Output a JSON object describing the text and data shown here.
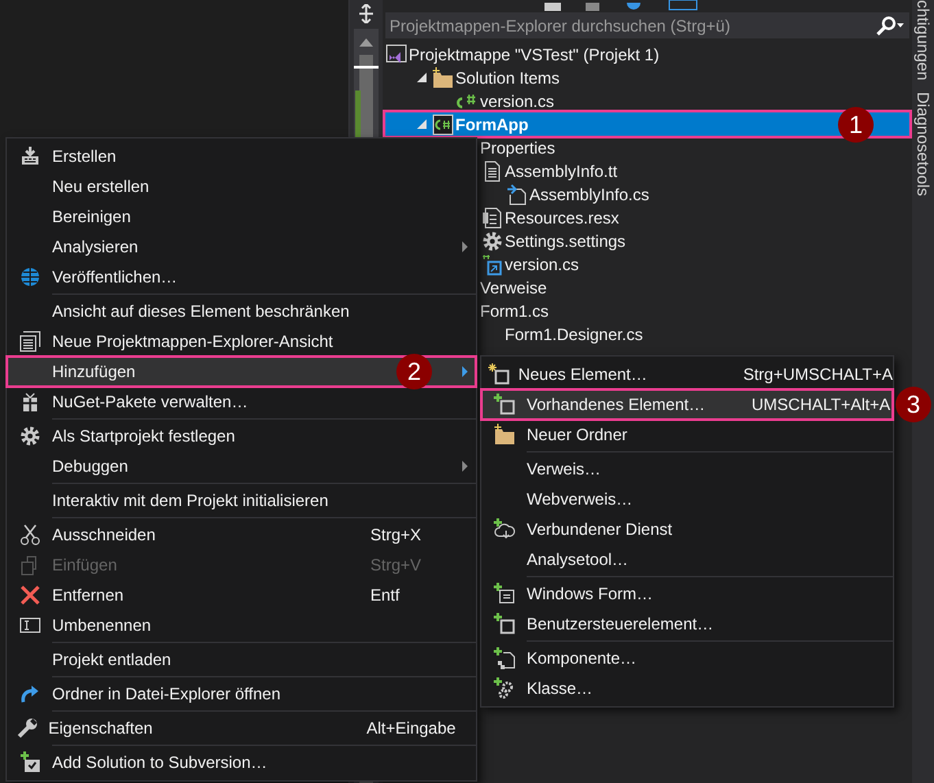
{
  "search": {
    "placeholder": "Projektmappen-Explorer durchsuchen (Strg+ü)"
  },
  "side_tabs": [
    {
      "label": "chtigungen"
    },
    {
      "label": "Diagnosetools"
    }
  ],
  "tree": [
    {
      "label": "Projektmappe \"VSTest\" (Projekt 1)",
      "selected": false,
      "children": [
        {
          "label": "Solution Items",
          "selected": false,
          "expanded": true,
          "children": [
            {
              "label": "version.cs",
              "selected": false
            }
          ]
        },
        {
          "label": "FormApp",
          "selected": true,
          "expanded": true,
          "callout": "1",
          "children": [
            {
              "label": "Properties",
              "selected": false,
              "children": [
                {
                  "label": "AssemblyInfo.tt",
                  "selected": false,
                  "children": [
                    {
                      "label": "AssemblyInfo.cs",
                      "selected": false
                    }
                  ]
                },
                {
                  "label": "Resources.resx",
                  "selected": false
                },
                {
                  "label": "Settings.settings",
                  "selected": false
                },
                {
                  "label": "version.cs",
                  "selected": false
                }
              ]
            },
            {
              "label": "Verweise",
              "selected": false
            },
            {
              "label": "Form1.cs",
              "selected": false,
              "children": [
                {
                  "label": "Form1.Designer.cs",
                  "selected": false
                }
              ]
            }
          ]
        }
      ]
    }
  ],
  "context_menu": {
    "items": [
      {
        "kind": "item",
        "label": "Erstellen",
        "selected": false,
        "disabled": false,
        "submenu": false
      },
      {
        "kind": "item",
        "label": "Neu erstellen",
        "selected": false,
        "disabled": false,
        "submenu": false
      },
      {
        "kind": "item",
        "label": "Bereinigen",
        "selected": false,
        "disabled": false,
        "submenu": false
      },
      {
        "kind": "item",
        "label": "Analysieren",
        "selected": false,
        "disabled": false,
        "submenu": true
      },
      {
        "kind": "item",
        "label": "Veröffentlichen…",
        "selected": false,
        "disabled": false,
        "submenu": false
      },
      {
        "kind": "separator"
      },
      {
        "kind": "item",
        "label": "Ansicht auf dieses Element beschränken",
        "selected": false,
        "disabled": false,
        "submenu": false
      },
      {
        "kind": "item",
        "label": "Neue Projektmappen-Explorer-Ansicht",
        "selected": false,
        "disabled": false,
        "submenu": false
      },
      {
        "kind": "item",
        "label": "Hinzufügen",
        "selected": true,
        "disabled": false,
        "submenu": true,
        "callout": "2"
      },
      {
        "kind": "item",
        "label": "NuGet-Pakete verwalten…",
        "selected": false,
        "disabled": false,
        "submenu": false
      },
      {
        "kind": "separator"
      },
      {
        "kind": "item",
        "label": "Als Startprojekt festlegen",
        "selected": false,
        "disabled": false,
        "submenu": false
      },
      {
        "kind": "item",
        "label": "Debuggen",
        "selected": false,
        "disabled": false,
        "submenu": true
      },
      {
        "kind": "separator"
      },
      {
        "kind": "item",
        "label": "Interaktiv mit dem Projekt initialisieren",
        "selected": false,
        "disabled": false,
        "submenu": false
      },
      {
        "kind": "separator"
      },
      {
        "kind": "item",
        "label": "Ausschneiden",
        "shortcut": "Strg+X",
        "selected": false,
        "disabled": false,
        "submenu": false
      },
      {
        "kind": "item",
        "label": "Einfügen",
        "shortcut": "Strg+V",
        "selected": false,
        "disabled": true,
        "submenu": false
      },
      {
        "kind": "item",
        "label": "Entfernen",
        "shortcut": "Entf",
        "selected": false,
        "disabled": false,
        "submenu": false
      },
      {
        "kind": "item",
        "label": "Umbenennen",
        "selected": false,
        "disabled": false,
        "submenu": false
      },
      {
        "kind": "separator"
      },
      {
        "kind": "item",
        "label": "Projekt entladen",
        "selected": false,
        "disabled": false,
        "submenu": false
      },
      {
        "kind": "separator"
      },
      {
        "kind": "item",
        "label": "Ordner in Datei-Explorer öffnen",
        "selected": false,
        "disabled": false,
        "submenu": false
      },
      {
        "kind": "separator"
      },
      {
        "kind": "item",
        "label": "Eigenschaften",
        "shortcut": "Alt+Eingabe",
        "selected": false,
        "disabled": false,
        "submenu": false
      },
      {
        "kind": "separator"
      },
      {
        "kind": "item",
        "label": "Add Solution to Subversion…",
        "selected": false,
        "disabled": false,
        "submenu": false
      }
    ]
  },
  "submenu": {
    "items": [
      {
        "kind": "item",
        "label": "Neues Element…",
        "shortcut": "Strg+UMSCHALT+A",
        "selected": false,
        "disabled": false
      },
      {
        "kind": "item",
        "label": "Vorhandenes Element…",
        "shortcut": "UMSCHALT+Alt+A",
        "selected": true,
        "disabled": false,
        "callout": "3"
      },
      {
        "kind": "item",
        "label": "Neuer Ordner",
        "selected": false,
        "disabled": false
      },
      {
        "kind": "separator"
      },
      {
        "kind": "item",
        "label": "Verweis…",
        "selected": false,
        "disabled": false
      },
      {
        "kind": "item",
        "label": "Webverweis…",
        "selected": false,
        "disabled": false
      },
      {
        "kind": "item",
        "label": "Verbundener Dienst",
        "selected": false,
        "disabled": false
      },
      {
        "kind": "item",
        "label": "Analysetool…",
        "selected": false,
        "disabled": false
      },
      {
        "kind": "separator"
      },
      {
        "kind": "item",
        "label": "Windows Form…",
        "selected": false,
        "disabled": false
      },
      {
        "kind": "item",
        "label": "Benutzersteuerelement…",
        "selected": false,
        "disabled": false
      },
      {
        "kind": "separator"
      },
      {
        "kind": "item",
        "label": "Komponente…",
        "selected": false,
        "disabled": false
      },
      {
        "kind": "item",
        "label": "Klasse…",
        "selected": false,
        "disabled": false
      }
    ]
  }
}
